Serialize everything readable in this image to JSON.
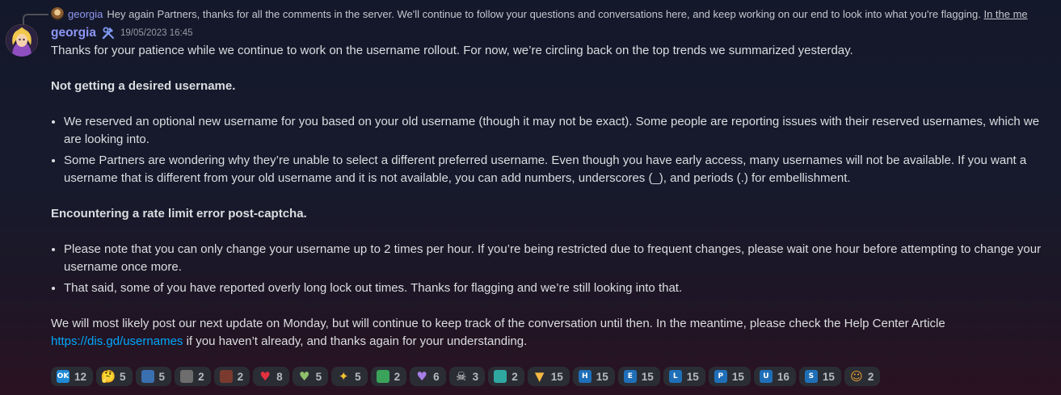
{
  "reply": {
    "author": "georgia",
    "text": "Hey again Partners, thanks for all the comments in the server. We'll continue to follow your questions and conversations here, and keep working on our end to look into what you're flagging.",
    "link_text": "In the me"
  },
  "message": {
    "author": "georgia",
    "timestamp": "19/05/2023 16:45",
    "intro": "Thanks for your patience while we continue to work on the username rollout. For now, we’re circling back on the top trends we summarized yesterday.",
    "section1_title": "Not getting a desired username.",
    "section1_items": [
      "We reserved an optional new username for you based on your old username (though it may not be exact). Some people are reporting issues with their reserved usernames, which we are looking into.",
      "Some Partners are wondering why they’re unable to select a different preferred username. Even though you have early access, many usernames will not be available. If you want a username that is different from your old username and it is not available, you can add numbers, underscores (_), and periods (.) for embellishment."
    ],
    "section2_title": "Encountering a rate limit error post-captcha.",
    "section2_items": [
      "Please note that you can only change your username up to 2 times per hour. If you’re being restricted due to frequent changes, please wait one hour before attempting to change your username once more.",
      "That said, some of you have reported overly long lock out times. Thanks for flagging and we’re still looking into that."
    ],
    "closing_before": "We will most likely post our next update on Monday, but will continue to keep track of the conversation until then. In the meantime, please check the Help Center Article",
    "closing_link": "https://dis.gd/usernames",
    "closing_after": " if you haven’t already, and thanks again for your understanding."
  },
  "reactions": [
    {
      "icon": "ok-icon",
      "label": "OK",
      "color": "#1f8ad6",
      "count": "12"
    },
    {
      "icon": "thinking-icon",
      "label": "",
      "color": "#e8c26a",
      "count": "5"
    },
    {
      "icon": "thank-you-icon",
      "label": "",
      "color": "#3a6fb0",
      "count": "5"
    },
    {
      "icon": "pixel-face-icon",
      "label": "",
      "color": "#6d6d6d",
      "count": "2"
    },
    {
      "icon": "tiny-text-icon",
      "label": "",
      "color": "#7a3b2e",
      "count": "2"
    },
    {
      "icon": "red-heart-icon",
      "label": "",
      "color": "#e5303f",
      "count": "8"
    },
    {
      "icon": "green-heart-icon",
      "label": "",
      "color": "#8fbf6a",
      "count": "5"
    },
    {
      "icon": "sparkles-icon",
      "label": "",
      "color": "#f4c430",
      "count": "5"
    },
    {
      "icon": "frog-icon",
      "label": "",
      "color": "#3aa35a",
      "count": "2"
    },
    {
      "icon": "purple-heart-icon",
      "label": "",
      "color": "#a77ee6",
      "count": "6"
    },
    {
      "icon": "skull-icon",
      "label": "",
      "color": "#e6e6e6",
      "count": "3"
    },
    {
      "icon": "turtle-icon",
      "label": "",
      "color": "#2fa8a0",
      "count": "2"
    },
    {
      "icon": "thumbs-down-icon",
      "label": "",
      "color": "#f5b942",
      "count": "15"
    },
    {
      "icon": "letter-h-icon",
      "label": "H",
      "color": "#1f6fb8",
      "count": "15"
    },
    {
      "icon": "letter-e-icon",
      "label": "E",
      "color": "#1f6fb8",
      "count": "15"
    },
    {
      "icon": "letter-l-icon",
      "label": "L",
      "color": "#1f6fb8",
      "count": "15"
    },
    {
      "icon": "letter-p-icon",
      "label": "P",
      "color": "#1f6fb8",
      "count": "15"
    },
    {
      "icon": "letter-u-icon",
      "label": "U",
      "color": "#1f6fb8",
      "count": "16"
    },
    {
      "icon": "letter-s-icon",
      "label": "S",
      "color": "#1f6fb8",
      "count": "15"
    },
    {
      "icon": "shrug-icon",
      "label": "",
      "color": "#f0a030",
      "count": "2"
    }
  ]
}
